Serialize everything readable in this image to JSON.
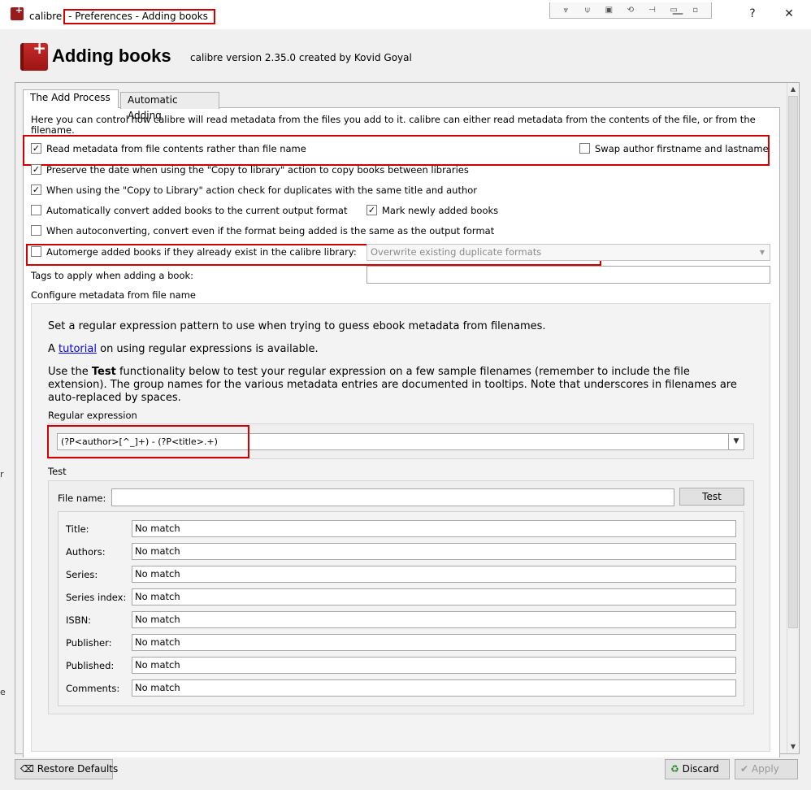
{
  "window": {
    "app_name": "calibre",
    "title_rest": "- Preferences - Adding books",
    "tool_icons": [
      "expand-icon",
      "pin-icon",
      "window-icon",
      "rotate-icon",
      "dock-icon",
      "minimize-bar-icon",
      "restore-icon"
    ],
    "buttons": {
      "minimize": "—",
      "help": "?",
      "close": "✕"
    }
  },
  "header": {
    "title": "Adding books",
    "subtitle": "calibre version 2.35.0 created by Kovid Goyal"
  },
  "tabs": [
    {
      "label": "The Add Process",
      "active": true
    },
    {
      "label": "Automatic Adding",
      "active": false
    }
  ],
  "add_process": {
    "description": "Here you can control how calibre will read metadata from the files you add to it. calibre can either read metadata from the contents of the file, or from the filename.",
    "options": {
      "read_metadata": {
        "label": "Read metadata from file contents rather than file name",
        "checked": true
      },
      "swap_author": {
        "label": "Swap author firstname and lastname",
        "checked": false
      },
      "preserve_date": {
        "label": "Preserve the date when using the \"Copy to library\" action to copy books between libraries",
        "checked": true
      },
      "check_duplicates": {
        "label": "When using the \"Copy to Library\" action check for duplicates with the same title and author",
        "checked": true
      },
      "auto_convert": {
        "label": "Automatically convert added books to the current output format",
        "checked": false
      },
      "mark_new": {
        "label": "Mark newly added books",
        "checked": true
      },
      "convert_same": {
        "label": "When autoconverting, convert even if the format being added is the same as the output format",
        "checked": false
      },
      "automerge": {
        "label": "Automerge added books if they already exist in the calibre library:",
        "checked": false
      }
    },
    "automerge_select": "Overwrite existing duplicate formats",
    "tags_label": "Tags to apply when adding a book:",
    "tags_value": "",
    "configure_label": "Configure metadata from file name"
  },
  "regex_panel": {
    "intro": "Set a regular expression pattern to use when trying to guess ebook metadata from filenames.",
    "tutorial_pre": "A",
    "tutorial_link": "tutorial",
    "tutorial_post": "on using regular expressions is available.",
    "test_pre": "Use the",
    "test_bold": "Test",
    "test_post": "functionality below to test your regular expression on a few sample filenames (remember to include the file extension). The group names for the various metadata entries are documented in tooltips. Note that underscores in filenames are auto-replaced by spaces.",
    "regex_label": "Regular expression",
    "regex_value": "(?P<author>[^_]+) - (?P<title>.+)",
    "test_group_label": "Test",
    "file_name_label": "File name:",
    "file_name_value": "",
    "test_button": "Test",
    "results": [
      {
        "label": "Title:",
        "value": "No match"
      },
      {
        "label": "Authors:",
        "value": "No match"
      },
      {
        "label": "Series:",
        "value": "No match"
      },
      {
        "label": "Series index:",
        "value": "No match"
      },
      {
        "label": "ISBN:",
        "value": "No match"
      },
      {
        "label": "Publisher:",
        "value": "No match"
      },
      {
        "label": "Published:",
        "value": "No match"
      },
      {
        "label": "Comments:",
        "value": "No match"
      }
    ]
  },
  "footer": {
    "restore_defaults": "Restore Defaults",
    "discard": "Discard",
    "apply": "Apply"
  },
  "colors": {
    "highlight": "#d40000",
    "brand": "#9b1b1b"
  }
}
